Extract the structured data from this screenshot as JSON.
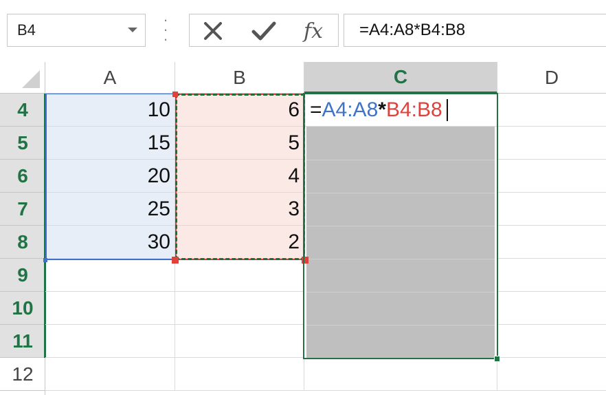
{
  "name_box": {
    "value": "B4"
  },
  "formula_bar": {
    "cancel_icon": "x-icon",
    "enter_icon": "check-icon",
    "function_icon": "fx-icon",
    "function_label": "fx",
    "formula": "=A4:A8*B4:B8"
  },
  "columns": [
    "A",
    "B",
    "C",
    "D"
  ],
  "rows": [
    "4",
    "5",
    "6",
    "7",
    "8",
    "9",
    "10",
    "11",
    "12"
  ],
  "cells": {
    "A": [
      "10",
      "15",
      "20",
      "25",
      "30"
    ],
    "B": [
      "6",
      "5",
      "4",
      "3",
      "2"
    ]
  },
  "editing_cell": {
    "address": "C4",
    "prefix": "=",
    "ref1": "A4:A8",
    "operator": "*",
    "ref2": "B4:B8"
  },
  "colors": {
    "accent_green": "#217346",
    "ref1_color": "#3f73c9",
    "ref2_color": "#e0413b",
    "ref1_fill": "#e8eef8",
    "ref2_fill": "#fbe9e5",
    "selection_fill": "#bfbfbf"
  }
}
